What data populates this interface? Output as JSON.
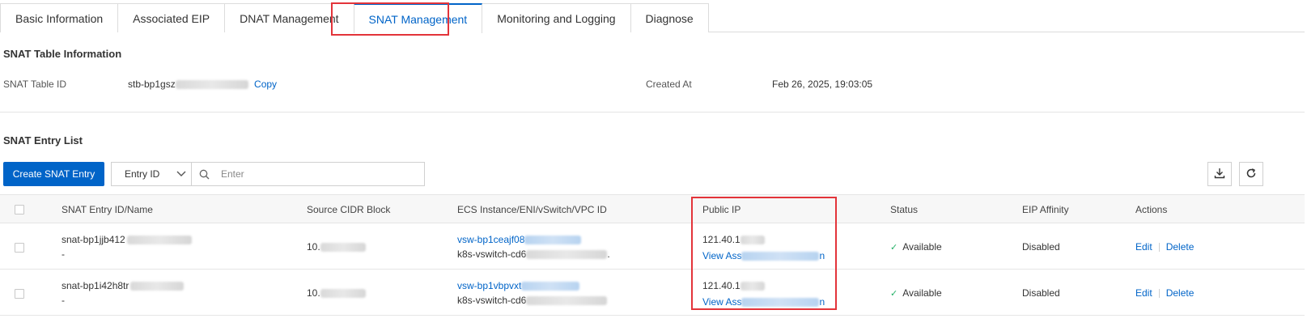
{
  "tabs": [
    {
      "label": "Basic Information"
    },
    {
      "label": "Associated EIP"
    },
    {
      "label": "DNAT Management"
    },
    {
      "label": "SNAT Management",
      "active": true
    },
    {
      "label": "Monitoring and Logging"
    },
    {
      "label": "Diagnose"
    }
  ],
  "snat_table": {
    "title": "SNAT Table Information",
    "id_label": "SNAT Table ID",
    "id_value": "stb-bp1gsz",
    "copy_label": "Copy",
    "created_label": "Created At",
    "created_value": "Feb 26, 2025, 19:03:05"
  },
  "entry_list": {
    "title": "SNAT Entry List",
    "create_button": "Create SNAT Entry",
    "filter_select": "Entry ID",
    "search_placeholder": "Enter"
  },
  "table": {
    "headers": {
      "entry": "SNAT Entry ID/Name",
      "cidr": "Source CIDR Block",
      "instance": "ECS Instance/ENI/vSwitch/VPC ID",
      "public_ip": "Public IP",
      "status": "Status",
      "affinity": "EIP Affinity",
      "actions": "Actions"
    },
    "rows": [
      {
        "entry_id": "snat-bp1jjb412",
        "entry_name": "-",
        "cidr": "10.",
        "vswitch_id": "vsw-bp1ceajf08",
        "vswitch_name": "k8s-vswitch-cd6",
        "vswitch_suffix": ".",
        "public_ip": "121.40.1",
        "view_assoc": "View Ass",
        "view_assoc_tail": "n",
        "status": "Available",
        "affinity": "Disabled",
        "edit": "Edit",
        "delete": "Delete"
      },
      {
        "entry_id": "snat-bp1i42h8tr",
        "entry_name": "-",
        "cidr": "10.",
        "vswitch_id": "vsw-bp1vbpvxt",
        "vswitch_name": "k8s-vswitch-cd6",
        "vswitch_suffix": "",
        "public_ip": "121.40.1",
        "view_assoc": "View Ass",
        "view_assoc_tail": "n",
        "status": "Available",
        "affinity": "Disabled",
        "edit": "Edit",
        "delete": "Delete"
      }
    ]
  },
  "icons": {
    "download": "download-icon",
    "refresh": "refresh-icon",
    "search": "search-icon",
    "chevron": "chevron-down-icon",
    "available": "check-icon"
  },
  "colors": {
    "accent": "#0064c8",
    "highlight": "#e3343a",
    "available": "#23b066"
  }
}
